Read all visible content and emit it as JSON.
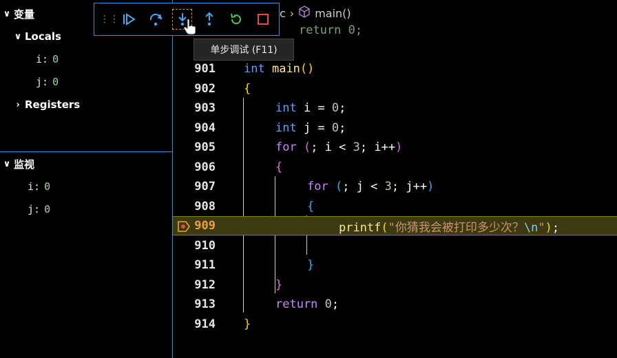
{
  "variables_panel": {
    "title": "变量",
    "locals": {
      "label": "Locals",
      "items": [
        {
          "name": "i:",
          "value": "0"
        },
        {
          "name": "j:",
          "value": "0"
        }
      ]
    },
    "registers": {
      "label": "Registers"
    }
  },
  "watch_panel": {
    "title": "监视",
    "items": [
      {
        "name": "i:",
        "value": "0"
      },
      {
        "name": "j:",
        "value": "0"
      }
    ]
  },
  "tooltip": "单步调试 (F11)",
  "breadcrumb": {
    "partial": "c",
    "symbol": "main()"
  },
  "editor": {
    "partial_top": "return 0;",
    "line_numbers": [
      "901",
      "902",
      "903",
      "904",
      "905",
      "906",
      "907",
      "908",
      "909",
      "910",
      "911",
      "912",
      "913",
      "914"
    ],
    "current_line": "909",
    "code": {
      "l901_kw": "int",
      "l901_fn": "main",
      "l901_paren": "()",
      "l902": "{",
      "l903_kw": "int",
      "l903_rest": " i = ",
      "l903_num": "0",
      "l903_end": ";",
      "l904_kw": "int",
      "l904_rest": " j = ",
      "l904_num": "0",
      "l904_end": ";",
      "l905_kw": "for",
      "l905_open": " (",
      "l905_mid": "; i < ",
      "l905_num": "3",
      "l905_rest": "; i++",
      "l905_close": ")",
      "l906": "{",
      "l907_kw": "for",
      "l907_open": " (",
      "l907_mid": "; j < ",
      "l907_num": "3",
      "l907_rest": "; j++",
      "l907_close": ")",
      "l908": "{",
      "l909_fn": "printf",
      "l909_open": "(",
      "l909_str": "\"你猜我会被打印多少次？",
      "l909_esc": "\\n",
      "l909_strend": "\"",
      "l909_close": ")",
      "l909_end": ";",
      "l911": "}",
      "l912": "}",
      "l913_kw": "return",
      "l913_num": " 0",
      "l913_end": ";",
      "l914": "}"
    }
  },
  "colors": {
    "accent": "#3a8fd0",
    "highlight": "#3c3a10",
    "stop": "#e74c3c",
    "continue": "#3fa9f5",
    "restart": "#4ec94e"
  }
}
